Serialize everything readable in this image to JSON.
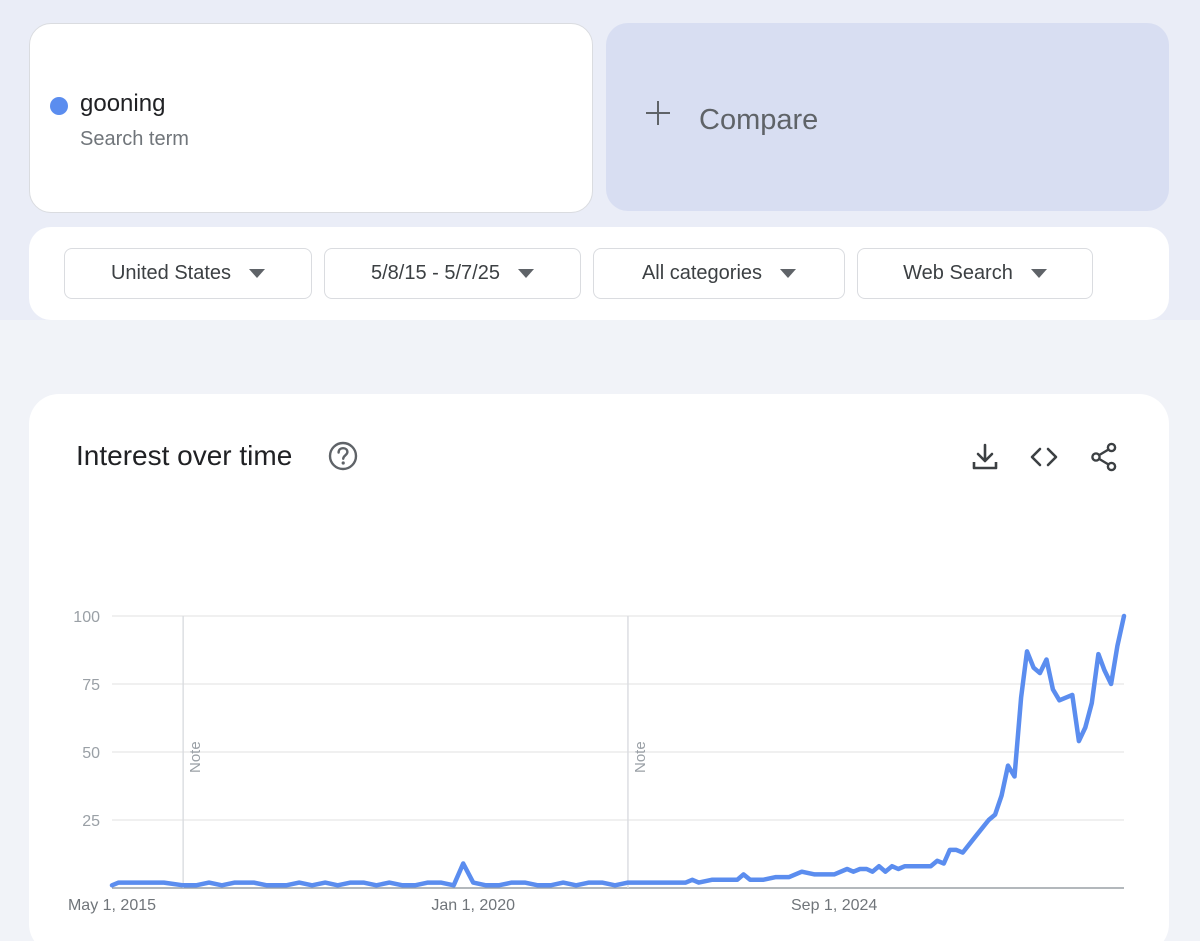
{
  "search_term": {
    "name": "gooning",
    "subtitle": "Search term",
    "color": "#5b8def"
  },
  "compare": {
    "label": "Compare"
  },
  "filters": [
    {
      "label": "United States"
    },
    {
      "label": "5/8/15 - 5/7/25"
    },
    {
      "label": "All categories"
    },
    {
      "label": "Web Search"
    }
  ],
  "panel": {
    "title": "Interest over time",
    "actions": [
      "download-icon",
      "embed-code-icon",
      "share-icon"
    ]
  },
  "colors": {
    "line": "#5b8def",
    "compare_bg": "#d8def2",
    "page_bg": "#eaedf7"
  },
  "chart_data": {
    "type": "line",
    "title": "Interest over time",
    "xlabel": "",
    "ylabel": "",
    "ylim": [
      0,
      100
    ],
    "yticks": [
      0,
      25,
      50,
      75,
      100
    ],
    "ytick_labels": [
      "100",
      "75",
      "50",
      "25"
    ],
    "grid": true,
    "xlim": [
      "2015-05-01",
      "2025-05-01"
    ],
    "xticks": [
      {
        "date": "2015-05-01",
        "label": "May 1, 2015"
      },
      {
        "date": "2020-01-01",
        "label": "Jan 1, 2020"
      },
      {
        "date": "2024-09-01",
        "label": "Sep 1, 2024"
      }
    ],
    "notes": [
      {
        "date": "2016-04-01",
        "label": "Note"
      },
      {
        "date": "2022-01-01",
        "label": "Note"
      }
    ],
    "series": [
      {
        "color": "#5b8def",
        "points": [
          [
            "2015-05-01",
            1
          ],
          [
            "2015-06-01",
            2
          ],
          [
            "2015-09-01",
            2
          ],
          [
            "2016-01-01",
            2
          ],
          [
            "2016-04-01",
            1
          ],
          [
            "2016-06-01",
            1
          ],
          [
            "2016-08-01",
            2
          ],
          [
            "2016-10-01",
            1
          ],
          [
            "2016-12-01",
            2
          ],
          [
            "2017-03-01",
            2
          ],
          [
            "2017-05-01",
            1
          ],
          [
            "2017-08-01",
            1
          ],
          [
            "2017-10-01",
            2
          ],
          [
            "2017-12-01",
            1
          ],
          [
            "2018-02-01",
            2
          ],
          [
            "2018-04-01",
            1
          ],
          [
            "2018-06-01",
            2
          ],
          [
            "2018-08-01",
            2
          ],
          [
            "2018-10-01",
            1
          ],
          [
            "2018-12-01",
            2
          ],
          [
            "2019-02-01",
            1
          ],
          [
            "2019-04-01",
            1
          ],
          [
            "2019-06-01",
            2
          ],
          [
            "2019-08-01",
            2
          ],
          [
            "2019-10-01",
            1
          ],
          [
            "2019-11-15",
            9
          ],
          [
            "2020-01-01",
            2
          ],
          [
            "2020-03-01",
            1
          ],
          [
            "2020-05-01",
            1
          ],
          [
            "2020-07-01",
            2
          ],
          [
            "2020-09-01",
            2
          ],
          [
            "2020-11-01",
            1
          ],
          [
            "2021-01-01",
            1
          ],
          [
            "2021-03-01",
            2
          ],
          [
            "2021-05-01",
            1
          ],
          [
            "2021-07-01",
            2
          ],
          [
            "2021-09-01",
            2
          ],
          [
            "2021-11-01",
            1
          ],
          [
            "2022-01-01",
            2
          ],
          [
            "2022-04-01",
            2
          ],
          [
            "2022-07-01",
            2
          ],
          [
            "2022-10-01",
            2
          ],
          [
            "2022-11-01",
            3
          ],
          [
            "2022-12-01",
            2
          ],
          [
            "2023-02-01",
            3
          ],
          [
            "2023-04-01",
            3
          ],
          [
            "2023-06-01",
            3
          ],
          [
            "2023-07-01",
            5
          ],
          [
            "2023-08-01",
            3
          ],
          [
            "2023-10-01",
            3
          ],
          [
            "2023-12-01",
            4
          ],
          [
            "2024-02-01",
            4
          ],
          [
            "2024-04-01",
            6
          ],
          [
            "2024-06-01",
            5
          ],
          [
            "2024-08-01",
            5
          ],
          [
            "2024-09-01",
            5
          ],
          [
            "2024-11-01",
            7
          ],
          [
            "2024-12-01",
            6
          ],
          [
            "2025-01-01",
            7
          ],
          [
            "2025-02-01",
            7
          ],
          [
            "2025-03-01",
            6
          ],
          [
            "2025-04-01",
            8
          ],
          [
            "2025-05-01",
            6
          ],
          [
            "2025-06-01",
            8
          ],
          [
            "2025-07-01",
            7
          ],
          [
            "2025-08-01",
            8
          ],
          [
            "2025-09-01",
            8
          ],
          [
            "2025-10-01",
            8
          ],
          [
            "2025-12-01",
            8
          ],
          [
            "2026-01-01",
            10
          ],
          [
            "2026-02-01",
            9
          ],
          [
            "2026-03-01",
            14
          ],
          [
            "2026-04-01",
            14
          ],
          [
            "2026-05-01",
            13
          ],
          [
            "2026-07-01",
            19
          ],
          [
            "2026-09-01",
            25
          ],
          [
            "2026-10-01",
            27
          ],
          [
            "2026-11-01",
            34
          ],
          [
            "2026-12-01",
            45
          ],
          [
            "2027-01-01",
            41
          ],
          [
            "2027-02-01",
            70
          ],
          [
            "2027-03-01",
            87
          ],
          [
            "2027-04-01",
            81
          ],
          [
            "2027-05-01",
            79
          ],
          [
            "2027-06-01",
            84
          ],
          [
            "2027-07-01",
            73
          ],
          [
            "2027-08-01",
            69
          ],
          [
            "2027-10-01",
            71
          ],
          [
            "2027-11-01",
            54
          ],
          [
            "2027-12-01",
            59
          ],
          [
            "2028-01-01",
            68
          ],
          [
            "2028-02-01",
            86
          ],
          [
            "2028-03-01",
            80
          ],
          [
            "2028-04-01",
            75
          ],
          [
            "2028-05-01",
            89
          ],
          [
            "2028-06-01",
            100
          ]
        ]
      }
    ]
  }
}
